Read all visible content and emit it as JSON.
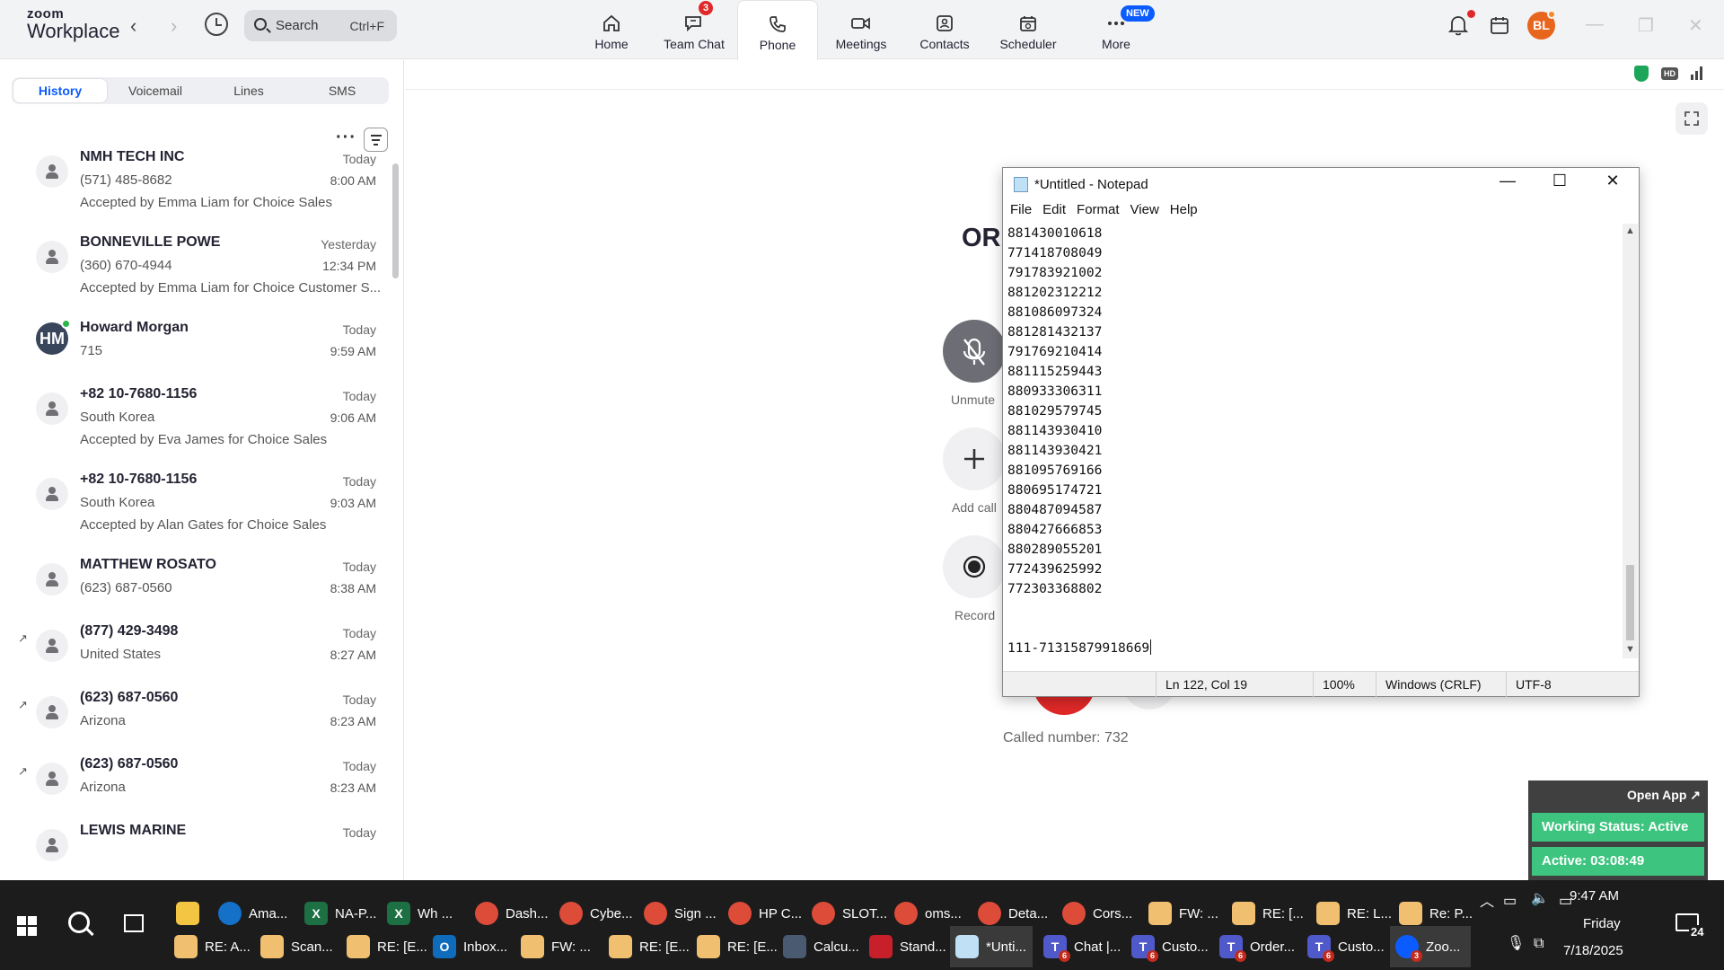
{
  "app": {
    "logo_line1": "zoom",
    "logo_line2": "Workplace"
  },
  "search": {
    "label": "Search",
    "shortcut": "Ctrl+F"
  },
  "nav": {
    "tabs": [
      {
        "label": "Home",
        "icon": "home-icon"
      },
      {
        "label": "Team Chat",
        "icon": "chat-icon",
        "badge": "3"
      },
      {
        "label": "Phone",
        "icon": "phone-icon",
        "active": true
      },
      {
        "label": "Meetings",
        "icon": "video-icon"
      },
      {
        "label": "Contacts",
        "icon": "contacts-icon"
      },
      {
        "label": "Scheduler",
        "icon": "calendar-icon"
      },
      {
        "label": "More",
        "icon": "more-icon",
        "badge": "NEW"
      }
    ]
  },
  "user": {
    "initials": "BL",
    "avatar_color": "#e8651e"
  },
  "phone": {
    "subtabs": [
      "History",
      "Voicemail",
      "Lines",
      "SMS"
    ],
    "active_subtab": "History",
    "history": [
      {
        "name": "NMH TECH INC",
        "line2": "(571) 485-8682",
        "line3": "Accepted by Emma Liam for Choice Sales",
        "date": "Today",
        "time": "8:00 AM"
      },
      {
        "name": "BONNEVILLE POWE",
        "line2": "(360) 670-4944",
        "line3": "Accepted by Emma Liam for Choice Customer S...",
        "date": "Yesterday",
        "time": "12:34 PM"
      },
      {
        "name": "Howard Morgan",
        "line2": "715",
        "initials": "HM",
        "date": "Today",
        "time": "9:59 AM"
      },
      {
        "name": "+82 10-7680-1156",
        "line2": "South Korea",
        "line3": "Accepted by Eva James for Choice Sales",
        "date": "Today",
        "time": "9:06 AM"
      },
      {
        "name": "+82 10-7680-1156",
        "line2": "South Korea",
        "line3": "Accepted by Alan Gates for Choice Sales",
        "date": "Today",
        "time": "9:03 AM"
      },
      {
        "name": "MATTHEW ROSATO",
        "line2": "(623) 687-0560",
        "date": "Today",
        "time": "8:38 AM"
      },
      {
        "name": "(877) 429-3498",
        "line2": "United States",
        "date": "Today",
        "time": "8:27 AM",
        "outgoing": true
      },
      {
        "name": "(623) 687-0560",
        "line2": "Arizona",
        "date": "Today",
        "time": "8:23 AM",
        "outgoing": true
      },
      {
        "name": "(623) 687-0560",
        "line2": "Arizona",
        "date": "Today",
        "time": "8:23 AM",
        "outgoing": true
      },
      {
        "name": "LEWIS MARINE",
        "date": "Today"
      }
    ]
  },
  "call": {
    "caller_partial": "OR",
    "buttons": [
      {
        "label": "Unmute",
        "icon": "mic-off-icon"
      },
      {
        "label": "Add call",
        "icon": "plus-icon"
      },
      {
        "label": "Record",
        "icon": "record-icon"
      }
    ],
    "called_number": "Called number: 732"
  },
  "notepad": {
    "title": "*Untitled - Notepad",
    "menu": [
      "File",
      "Edit",
      "Format",
      "View",
      "Help"
    ],
    "lines": [
      "881430010618",
      "771418708049",
      "791783921002",
      "881202312212",
      "881086097324",
      "881281432137",
      "791769210414",
      "881115259443",
      "880933306311",
      "881029579745",
      "881143930410",
      "881143930421",
      "881095769166",
      "880695174721",
      "880487094587",
      "880427666853",
      "880289055201",
      "772439625992",
      "772303368802",
      "",
      "",
      "111-71315879918669"
    ],
    "status": {
      "position": "Ln 122, Col 19",
      "zoom": "100%",
      "line_ending": "Windows (CRLF)",
      "encoding": "UTF-8"
    }
  },
  "status_widget": {
    "open_app": "Open App ↗",
    "working_status": "Working Status: Active",
    "active_timer": "Active: 03:08:49"
  },
  "taskbar": {
    "row1": [
      {
        "label": "",
        "color": "#f4c542",
        "icon": "folder-icon"
      },
      {
        "label": "Ama...",
        "color": "#1570c8",
        "icon": "edge-icon"
      },
      {
        "label": "NA-P...",
        "color": "#1d7044",
        "icon": "excel-icon",
        "glyph": "X"
      },
      {
        "label": "Wh ...",
        "color": "#1d7044",
        "icon": "excel-icon",
        "glyph": "X"
      },
      {
        "label": "Dash...",
        "color": "#dd4b39",
        "icon": "chrome-icon"
      },
      {
        "label": "Cybe...",
        "color": "#dd4b39",
        "icon": "chrome-icon"
      },
      {
        "label": "Sign ...",
        "color": "#dd4b39",
        "icon": "chrome-icon"
      },
      {
        "label": "HP C...",
        "color": "#dd4b39",
        "icon": "chrome-icon"
      },
      {
        "label": "SLOT...",
        "color": "#dd4b39",
        "icon": "chrome-icon"
      },
      {
        "label": "oms...",
        "color": "#dd4b39",
        "icon": "chrome-icon"
      },
      {
        "label": "Deta...",
        "color": "#dd4b39",
        "icon": "chrome-icon"
      },
      {
        "label": "Cors...",
        "color": "#dd4b39",
        "icon": "chrome-icon"
      },
      {
        "label": "FW: ...",
        "color": "#f0c070",
        "icon": "mail-icon"
      },
      {
        "label": "RE: [...",
        "color": "#f0c070",
        "icon": "mail-icon"
      },
      {
        "label": "RE: L...",
        "color": "#f0c070",
        "icon": "mail-icon"
      },
      {
        "label": "Re: P...",
        "color": "#f0c070",
        "icon": "mail-icon"
      }
    ],
    "row2": [
      {
        "label": "RE: A...",
        "color": "#f0c070",
        "icon": "mail-icon"
      },
      {
        "label": "Scan...",
        "color": "#f0c070",
        "icon": "mail-icon"
      },
      {
        "label": "RE: [E...",
        "color": "#f0c070",
        "icon": "mail-icon"
      },
      {
        "label": "Inbox...",
        "color": "#0f6cbd",
        "icon": "outlook-icon",
        "glyph": "O"
      },
      {
        "label": "FW: ...",
        "color": "#f0c070",
        "icon": "mail-icon"
      },
      {
        "label": "RE: [E...",
        "color": "#f0c070",
        "icon": "mail-icon"
      },
      {
        "label": "RE: [E...",
        "color": "#f0c070",
        "icon": "mail-icon"
      },
      {
        "label": "Calcu...",
        "color": "#4a5a70",
        "icon": "calculator-icon"
      },
      {
        "label": "Stand...",
        "color": "#c8202a",
        "icon": "pdf-icon"
      },
      {
        "label": "*Unti...",
        "color": "#bfe0f5",
        "icon": "notepad-icon",
        "active": true
      },
      {
        "label": "Chat |...",
        "color": "#5059c9",
        "icon": "teams-icon",
        "glyph": "T",
        "badge": "6"
      },
      {
        "label": "Custo...",
        "color": "#5059c9",
        "icon": "teams-icon",
        "glyph": "T",
        "badge": "6"
      },
      {
        "label": "Order...",
        "color": "#5059c9",
        "icon": "teams-icon",
        "glyph": "T",
        "badge": "6"
      },
      {
        "label": "Custo...",
        "color": "#5059c9",
        "icon": "teams-icon",
        "glyph": "T",
        "badge": "6"
      },
      {
        "label": "Zoo...",
        "color": "#0b5cff",
        "icon": "zoom-icon",
        "badge": "3",
        "active": true
      }
    ],
    "clock": {
      "time": "9:47 AM",
      "day": "Friday",
      "date": "7/18/2025"
    },
    "notification_count": "24"
  },
  "colors": {
    "accent": "#0b5cff",
    "active_green": "#3dc47e",
    "danger": "#e02828"
  }
}
